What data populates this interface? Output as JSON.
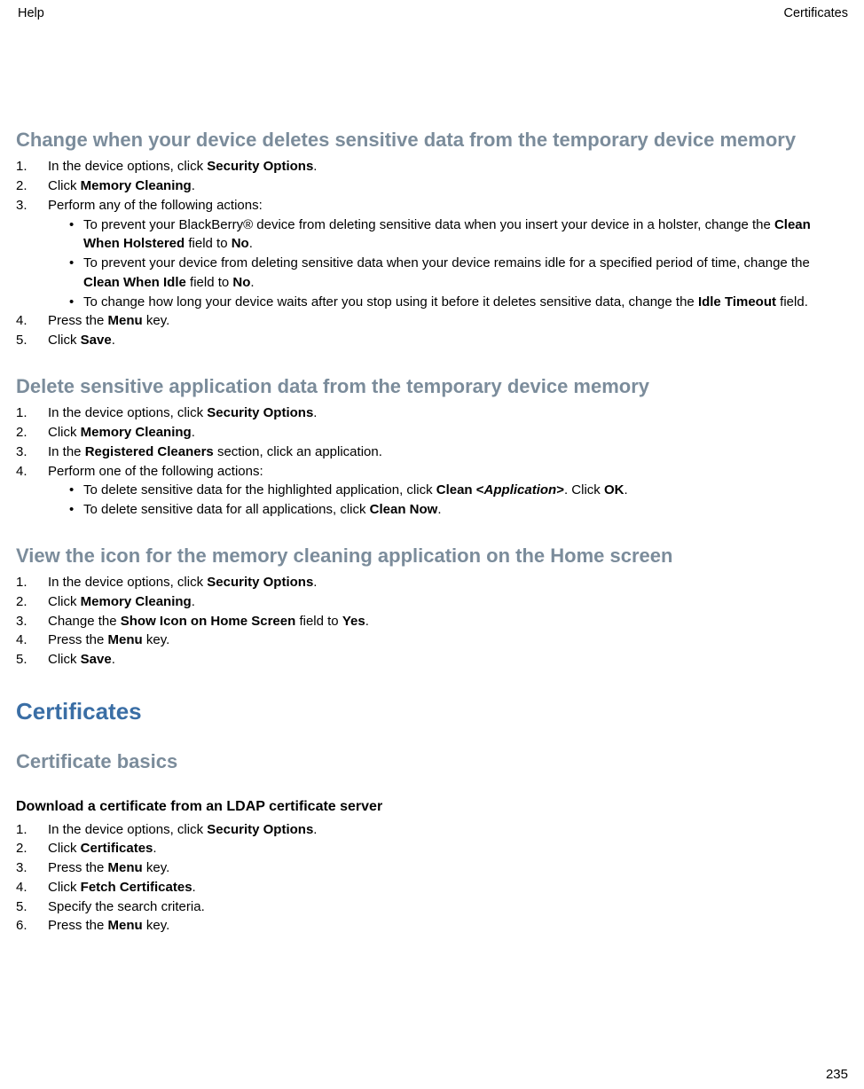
{
  "header": {
    "left": "Help",
    "right": "Certificates"
  },
  "sections": [
    {
      "heading_level": "h2",
      "heading": "Change when your device deletes sensitive data from the temporary device memory",
      "steps": [
        {
          "html": "In the device options, click <b>Security Options</b>."
        },
        {
          "html": "Click <b>Memory Cleaning</b>."
        },
        {
          "html": "Perform any of the following actions:",
          "bullets": [
            {
              "html": "To prevent your BlackBerry® device from deleting sensitive data when you insert your device in a holster, change the <b>Clean When Holstered</b> field to <b>No</b>."
            },
            {
              "html": "To prevent your device from deleting sensitive data when your device remains idle for a specified period of time, change the <b>Clean When Idle</b> field to <b>No</b>."
            },
            {
              "html": "To change how long your device waits after you stop using it before it deletes sensitive data, change the <b>Idle Timeout</b> field."
            }
          ]
        },
        {
          "html": "Press the <b>Menu</b> key."
        },
        {
          "html": "Click <b>Save</b>."
        }
      ]
    },
    {
      "heading_level": "h2",
      "heading": "Delete sensitive application data from the temporary device memory",
      "steps": [
        {
          "html": "In the device options, click <b>Security Options</b>."
        },
        {
          "html": "Click <b>Memory Cleaning</b>."
        },
        {
          "html": "In the <b>Registered Cleaners</b> section, click an application."
        },
        {
          "html": "Perform one of the following actions:",
          "bullets": [
            {
              "html": "To delete sensitive data for the highlighted application, click <b>Clean &lt;<i>Application</i>&gt;</b>. Click <b>OK</b>."
            },
            {
              "html": "To delete sensitive data for all applications, click <b>Clean Now</b>."
            }
          ]
        }
      ]
    },
    {
      "heading_level": "h2",
      "heading": "View the icon for the memory cleaning application on the Home screen",
      "steps": [
        {
          "html": "In the device options, click <b>Security Options</b>."
        },
        {
          "html": "Click <b>Memory Cleaning</b>."
        },
        {
          "html": "Change the <b>Show Icon on Home Screen</b> field to <b>Yes</b>."
        },
        {
          "html": "Press the <b>Menu</b> key."
        },
        {
          "html": "Click <b>Save</b>."
        }
      ]
    },
    {
      "heading_level": "h1",
      "heading": "Certificates"
    },
    {
      "heading_level": "h3",
      "heading": "Certificate basics"
    },
    {
      "heading_level": "h4",
      "heading": "Download a certificate from an LDAP certificate server",
      "steps": [
        {
          "html": "In the device options, click <b>Security Options</b>."
        },
        {
          "html": "Click <b>Certificates</b>."
        },
        {
          "html": "Press the <b>Menu</b> key."
        },
        {
          "html": "Click <b>Fetch Certificates</b>."
        },
        {
          "html": "Specify the search criteria."
        },
        {
          "html": "Press the <b>Menu</b> key."
        }
      ]
    }
  ],
  "page_number": "235"
}
